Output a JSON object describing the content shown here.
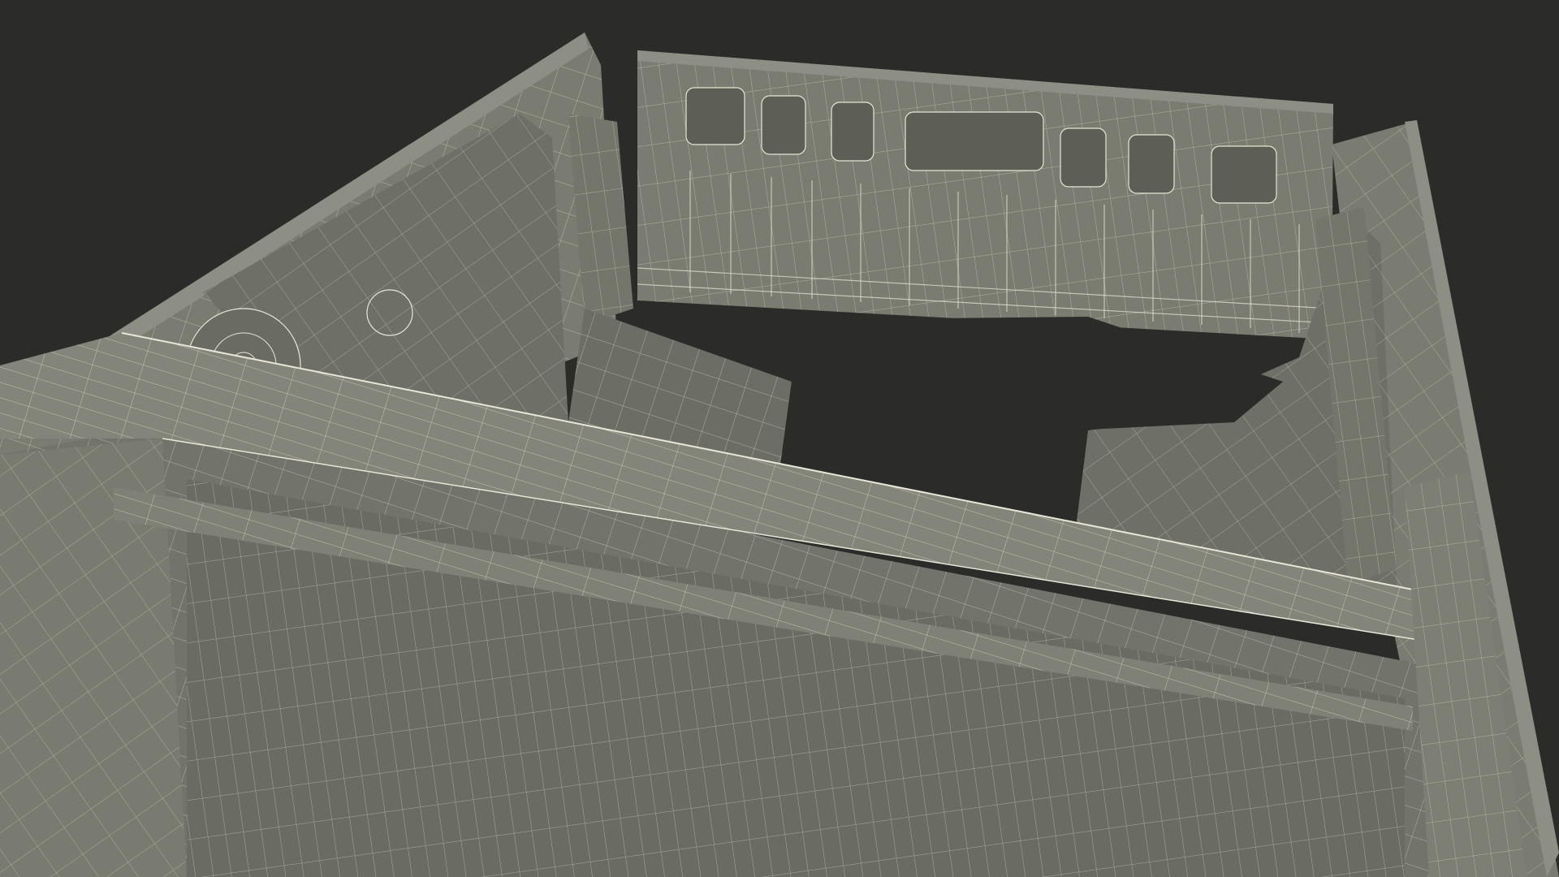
{
  "scene": {
    "subject": "wireframe-3d-model",
    "background_color": "#2b2b2a",
    "surface_color": "#7a7b71",
    "surface_dark": "#5d5e56",
    "surface_light": "#8d8e84",
    "wire_color": "#e8e6d6",
    "shadow_color": "#45463f"
  }
}
